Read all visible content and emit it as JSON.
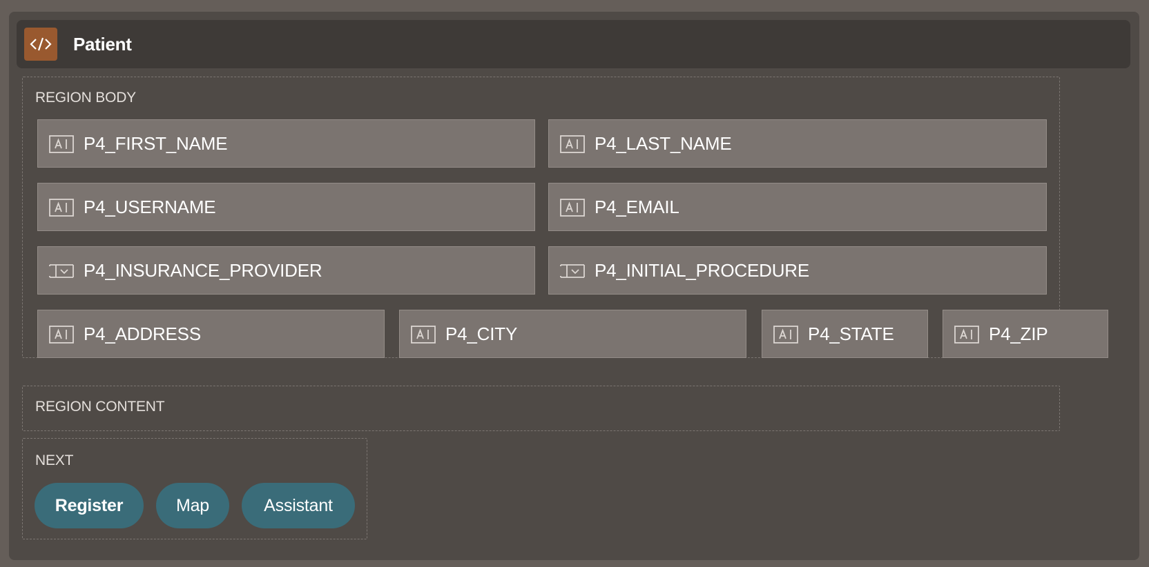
{
  "header": {
    "title": "Patient",
    "icon": "code-icon"
  },
  "region_body": {
    "label": "REGION BODY",
    "fields": [
      {
        "label": "P4_FIRST_NAME",
        "icon": "text-field-icon"
      },
      {
        "label": "P4_LAST_NAME",
        "icon": "text-field-icon"
      },
      {
        "label": "P4_USERNAME",
        "icon": "text-field-icon"
      },
      {
        "label": "P4_EMAIL",
        "icon": "text-field-icon"
      },
      {
        "label": "P4_INSURANCE_PROVIDER",
        "icon": "select-list-icon"
      },
      {
        "label": "P4_INITIAL_PROCEDURE",
        "icon": "select-list-icon"
      },
      {
        "label": "P4_ADDRESS",
        "icon": "text-field-icon"
      },
      {
        "label": "P4_CITY",
        "icon": "text-field-icon"
      },
      {
        "label": "P4_STATE",
        "icon": "text-field-icon"
      },
      {
        "label": "P4_ZIP",
        "icon": "text-field-icon"
      }
    ]
  },
  "region_content": {
    "label": "REGION CONTENT"
  },
  "next": {
    "label": "NEXT",
    "buttons": [
      {
        "label": "Register"
      },
      {
        "label": "Map"
      },
      {
        "label": "Assistant"
      }
    ]
  },
  "colors": {
    "page_bg": "#655e59",
    "panel_bg": "#4f4a46",
    "header_bg": "#3e3a37",
    "header_icon_bg": "#99592f",
    "field_bg": "#7b7470",
    "button_bg": "#3a6c79"
  }
}
